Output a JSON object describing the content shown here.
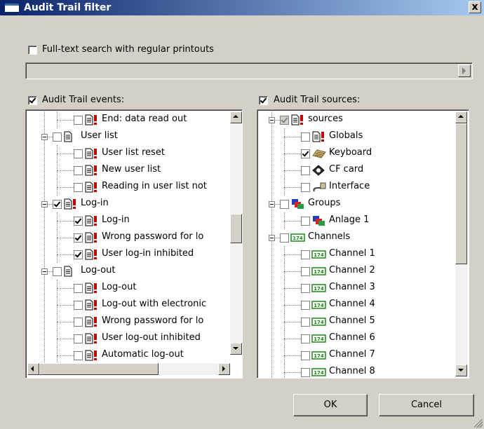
{
  "window": {
    "title": "Audit Trail filter",
    "close_label": "x"
  },
  "search": {
    "checkbox_label": "Full-text search with regular printouts",
    "checked": false,
    "value": ""
  },
  "events_panel": {
    "header_label": "Audit Trail events:",
    "header_checked": true,
    "rows": [
      {
        "level": 2,
        "label": "End: data read out",
        "icon": "document-alert-icon",
        "checked": false
      },
      {
        "level": 1,
        "label": "User list",
        "icon": "document-icon",
        "checked": false
      },
      {
        "level": 2,
        "label": "User list reset",
        "icon": "document-alert-icon",
        "checked": false
      },
      {
        "level": 2,
        "label": "New user list",
        "icon": "document-alert-icon",
        "checked": false
      },
      {
        "level": 2,
        "label": "Reading in user list not",
        "icon": "document-alert-icon",
        "checked": false
      },
      {
        "level": 1,
        "label": "Log-in",
        "icon": "document-alert-icon",
        "checked": true
      },
      {
        "level": 2,
        "label": "Log-in",
        "icon": "document-alert-icon",
        "checked": true
      },
      {
        "level": 2,
        "label": "Wrong password for lo",
        "icon": "document-alert-icon",
        "checked": true
      },
      {
        "level": 2,
        "label": "User log-in inhibited",
        "icon": "document-alert-icon",
        "checked": true
      },
      {
        "level": 1,
        "label": "Log-out",
        "icon": "document-icon",
        "checked": false
      },
      {
        "level": 2,
        "label": "Log-out",
        "icon": "document-alert-icon",
        "checked": false
      },
      {
        "level": 2,
        "label": "Log-out with electronic",
        "icon": "document-alert-icon",
        "checked": false
      },
      {
        "level": 2,
        "label": "Wrong password for lo",
        "icon": "document-alert-icon",
        "checked": false
      },
      {
        "level": 2,
        "label": "User log-out inhibited",
        "icon": "document-alert-icon",
        "checked": false
      },
      {
        "level": 2,
        "label": "Automatic log-out",
        "icon": "document-alert-icon",
        "checked": false
      }
    ]
  },
  "sources_panel": {
    "header_label": "Audit Trail sources:",
    "header_checked": true,
    "rows": [
      {
        "level": 1,
        "label": "sources",
        "icon": "document-alert-icon",
        "checked": true,
        "grayed": true
      },
      {
        "level": 2,
        "label": "Globals",
        "icon": "document-alert-icon",
        "checked": false
      },
      {
        "level": 2,
        "label": "Keyboard",
        "icon": "keyboard-icon",
        "checked": true
      },
      {
        "level": 2,
        "label": "CF card",
        "icon": "cf-card-icon",
        "checked": false
      },
      {
        "level": 2,
        "label": "Interface",
        "icon": "interface-icon",
        "checked": false
      },
      {
        "level": 1,
        "label": "Groups",
        "icon": "groups-icon",
        "checked": false
      },
      {
        "level": 2,
        "label": "Anlage 1",
        "icon": "groups-icon",
        "checked": false
      },
      {
        "level": 1,
        "label": "Channels",
        "icon": "channel-icon",
        "checked": false
      },
      {
        "level": 2,
        "label": "Channel 1",
        "icon": "channel-icon",
        "checked": false
      },
      {
        "level": 2,
        "label": "Channel 2",
        "icon": "channel-icon",
        "checked": false
      },
      {
        "level": 2,
        "label": "Channel 3",
        "icon": "channel-icon",
        "checked": false
      },
      {
        "level": 2,
        "label": "Channel 4",
        "icon": "channel-icon",
        "checked": false
      },
      {
        "level": 2,
        "label": "Channel 5",
        "icon": "channel-icon",
        "checked": false
      },
      {
        "level": 2,
        "label": "Channel 6",
        "icon": "channel-icon",
        "checked": false
      },
      {
        "level": 2,
        "label": "Channel 7",
        "icon": "channel-icon",
        "checked": false
      },
      {
        "level": 2,
        "label": "Channel 8",
        "icon": "channel-icon",
        "checked": false
      }
    ]
  },
  "buttons": {
    "ok_label": "OK",
    "cancel_label": "Cancel"
  },
  "colors": {
    "window_bg": "#d4d0c8",
    "title_start": "#0a246a",
    "title_end": "#a6caf0",
    "alert_red": "#c00000",
    "channel_green": "#1a8a1a"
  }
}
